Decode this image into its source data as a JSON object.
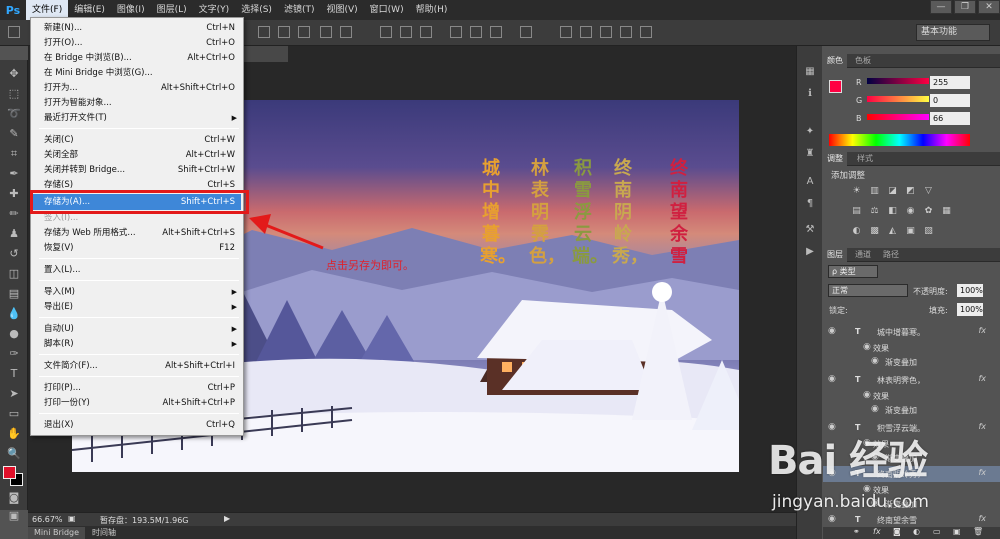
{
  "app": {
    "logo": "Ps",
    "menubar": [
      {
        "label": "文件(F)"
      },
      {
        "label": "编辑(E)"
      },
      {
        "label": "图像(I)"
      },
      {
        "label": "图层(L)"
      },
      {
        "label": "文字(Y)"
      },
      {
        "label": "选择(S)"
      },
      {
        "label": "滤镜(T)"
      },
      {
        "label": "视图(V)"
      },
      {
        "label": "窗口(W)"
      },
      {
        "label": "帮助(H)"
      }
    ],
    "window_controls": {
      "minimize": "—",
      "restore": "❐",
      "close": "✕"
    }
  },
  "options_bar": {
    "workspace": "基本功能"
  },
  "file_menu": {
    "items": [
      {
        "label": "新建(N)...",
        "shortcut": "Ctrl+N"
      },
      {
        "label": "打开(O)...",
        "shortcut": "Ctrl+O"
      },
      {
        "label": "在 Bridge 中浏览(B)...",
        "shortcut": "Alt+Ctrl+O"
      },
      {
        "label": "在 Mini Bridge 中浏览(G)...",
        "shortcut": ""
      },
      {
        "label": "打开为...",
        "shortcut": "Alt+Shift+Ctrl+O"
      },
      {
        "label": "打开为智能对象...",
        "shortcut": ""
      },
      {
        "label": "最近打开文件(T)",
        "shortcut": ""
      },
      {
        "label": "关闭(C)",
        "shortcut": "Ctrl+W"
      },
      {
        "label": "关闭全部",
        "shortcut": "Alt+Ctrl+W"
      },
      {
        "label": "关闭并转到 Bridge...",
        "shortcut": "Shift+Ctrl+W"
      },
      {
        "label": "存储(S)",
        "shortcut": "Ctrl+S"
      },
      {
        "label": "存储为(A)...",
        "shortcut": "Shift+Ctrl+S"
      },
      {
        "label": "签入(I)...",
        "shortcut": ""
      },
      {
        "label": "存储为 Web 所用格式...",
        "shortcut": "Alt+Shift+Ctrl+S"
      },
      {
        "label": "恢复(V)",
        "shortcut": "F12"
      },
      {
        "label": "置入(L)...",
        "shortcut": ""
      },
      {
        "label": "导入(M)",
        "shortcut": ""
      },
      {
        "label": "导出(E)",
        "shortcut": ""
      },
      {
        "label": "自动(U)",
        "shortcut": ""
      },
      {
        "label": "脚本(R)",
        "shortcut": ""
      },
      {
        "label": "文件简介(F)...",
        "shortcut": "Alt+Shift+Ctrl+I"
      },
      {
        "label": "打印(P)...",
        "shortcut": "Ctrl+P"
      },
      {
        "label": "打印一份(Y)",
        "shortcut": "Alt+Shift+Ctrl+P"
      },
      {
        "label": "退出(X)",
        "shortcut": "Ctrl+Q"
      }
    ]
  },
  "annotation": {
    "text": "点击另存为即可。",
    "color": "#e31a1a"
  },
  "canvas": {
    "poem_columns": [
      {
        "text": "城中增暮寒。",
        "color": "#e8a030"
      },
      {
        "text": "林表明霁色，",
        "color": "#d4a040"
      },
      {
        "text": "积雪浮云端。",
        "color": "#8a9a40"
      },
      {
        "text": "终南阴岭秀，",
        "color": "#c8a850"
      },
      {
        "text": "终南望余雪",
        "color": "#d02040"
      }
    ]
  },
  "status": {
    "zoom": "66.67%",
    "doc_info": "暂存盘：193.5M/1.96G",
    "tabs": [
      "Mini Bridge",
      "时间轴"
    ]
  },
  "color_panel": {
    "tabs": [
      "颜色",
      "色板"
    ],
    "r_label": "R",
    "g_label": "G",
    "b_label": "B",
    "r": "255",
    "g": "0",
    "b": "66",
    "foreground": "#ff0042"
  },
  "adjustments_panel": {
    "tabs": [
      "调整",
      "样式"
    ],
    "title": "添加调整"
  },
  "layers_panel": {
    "tabs": [
      "图层",
      "通道",
      "路径"
    ],
    "kind_filter": "ρ 类型",
    "blend_mode": "正常",
    "opacity_label": "不透明度:",
    "opacity": "100%",
    "lock_label": "锁定:",
    "fill_label": "填充:",
    "fill": "100%",
    "layers": [
      {
        "name": "城中增暮寒。",
        "type": "T",
        "fx": "fx"
      },
      {
        "name": "效果",
        "type": "sub"
      },
      {
        "name": "渐变叠加",
        "type": "subsub"
      },
      {
        "name": "林表明霁色，",
        "type": "T",
        "fx": "fx"
      },
      {
        "name": "效果",
        "type": "sub"
      },
      {
        "name": "渐变叠加",
        "type": "subsub"
      },
      {
        "name": "积雪浮云端。",
        "type": "T",
        "fx": "fx"
      },
      {
        "name": "效果",
        "type": "sub"
      },
      {
        "name": "渐变叠加",
        "type": "subsub"
      },
      {
        "name": "终南阴岭秀，",
        "type": "T",
        "fx": "fx",
        "selected": true
      },
      {
        "name": "效果",
        "type": "sub"
      },
      {
        "name": "渐变叠加",
        "type": "subsub"
      },
      {
        "name": "终南望余雪",
        "type": "T",
        "fx": "fx"
      }
    ]
  },
  "watermark": {
    "logo": "Bai 经验",
    "url": "jingyan.baidu.com"
  }
}
